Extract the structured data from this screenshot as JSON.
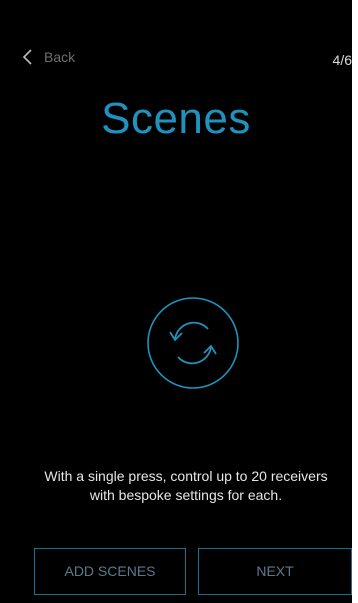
{
  "header": {
    "back_label": "Back",
    "step_indicator": "4/6"
  },
  "main": {
    "title": "Scenes",
    "icon": "sync-scenes-icon",
    "description_line1": "With a single press, control up to 20 receivers",
    "description_line2": "with bespoke settings for each."
  },
  "footer": {
    "add_scenes_label": "ADD SCENES",
    "next_label": "NEXT"
  },
  "colors": {
    "background": "#000000",
    "accent": "#1f93be",
    "button_border": "#1d6d8d",
    "button_text": "#5b7a88"
  }
}
